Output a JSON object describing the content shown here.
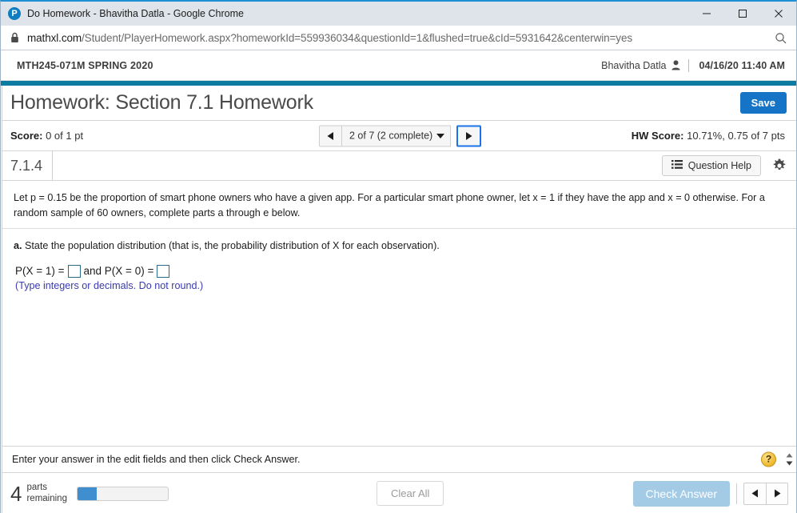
{
  "window": {
    "title": "Do Homework - Bhavitha Datla - Google Chrome",
    "favicon_letter": "P",
    "favicon_name": "pearson-favicon",
    "minimize_label": "Minimize",
    "maximize_label": "Maximize",
    "close_label": "Close"
  },
  "address_bar": {
    "lock_icon": "lock-icon",
    "url_domain": "mathxl.com",
    "url_path": "/Student/PlayerHomework.aspx?homeworkId=559936034&questionId=1&flushed=true&cId=5931642&centerwin=yes",
    "search_icon": "search-icon"
  },
  "course_bar": {
    "course": "MTH245-071M SPRING 2020",
    "user_name": "Bhavitha Datla",
    "user_icon": "person-icon",
    "timestamp": "04/16/20 11:40 AM"
  },
  "header": {
    "title": "Homework: Section 7.1 Homework",
    "save_label": "Save"
  },
  "score_bar": {
    "score_label": "Score:",
    "score_value": "0 of 1 pt",
    "prev_icon": "triangle-left-icon",
    "pager_value": "2 of 7 (2 complete)",
    "pager_caret": "triangle-down-icon",
    "next_icon": "triangle-right-icon",
    "hw_score_label": "HW Score:",
    "hw_score_value": "10.71%, 0.75 of 7 pts"
  },
  "question_bar": {
    "question_id": "7.1.4",
    "question_help_label": "Question Help",
    "question_help_icon": "list-icon",
    "settings_icon": "gear-icon"
  },
  "problem": {
    "stem": "Let p = 0.15 be the proportion of smart phone owners who have a given app. For a particular smart phone owner, let x = 1 if they have the app and x = 0 otherwise. For a random sample of 60 owners, complete parts a through e below.",
    "part_letter": "a.",
    "part_text": "State the population distribution (that is, the probability distribution of X for each observation).",
    "answer_prefix": "P(X = 1) =",
    "answer_middle": "and P(X = 0) =",
    "field_1_value": "",
    "field_2_value": "",
    "hint": "(Type integers or decimals. Do not round.)"
  },
  "footer_message": {
    "text": "Enter your answer in the edit fields and then click Check Answer.",
    "help_icon": "question-mark-icon",
    "scroll_up_icon": "scroll-up-icon",
    "scroll_down_icon": "scroll-down-icon"
  },
  "bottom_bar": {
    "parts_count": "4",
    "parts_label_line1": "parts",
    "parts_label_line2": "remaining",
    "progress_percent": 21,
    "clear_all_label": "Clear All",
    "check_answer_label": "Check Answer",
    "nav_prev_icon": "triangle-left-icon",
    "nav_next_icon": "triangle-right-icon"
  },
  "colors": {
    "teal_band": "#0c7ba2",
    "save_blue": "#1674c6",
    "check_answer_blue": "#a3cbe6",
    "progress_blue": "#3f8ed0",
    "focus_ring": "#1a73e8",
    "hint_purple": "#3a3ab0",
    "help_yellow": "#edb82e"
  }
}
